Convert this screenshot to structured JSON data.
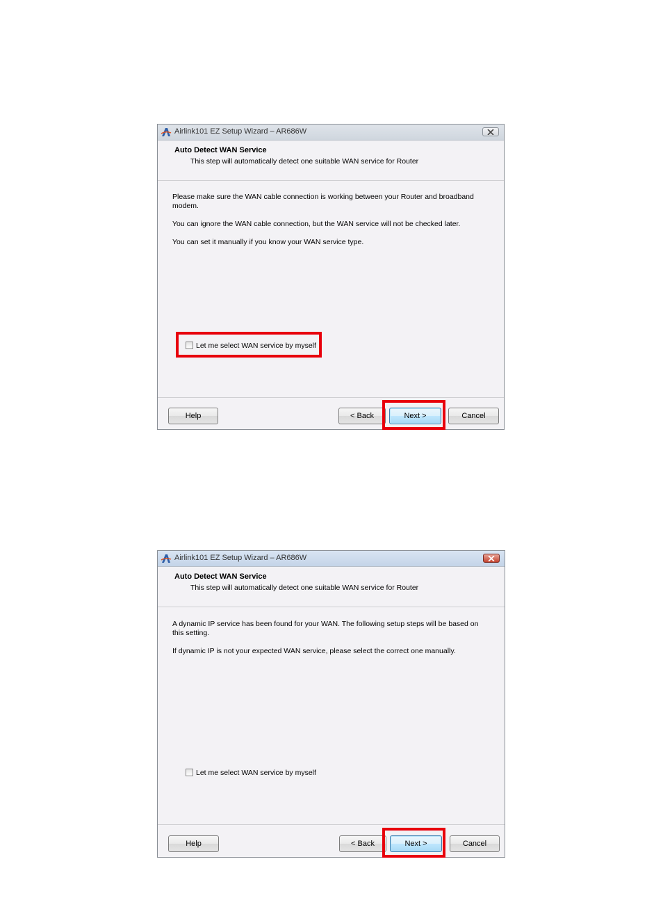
{
  "dialogs": [
    {
      "window_title": "Airlink101 EZ Setup Wizard – AR686W",
      "header_title": "Auto Detect WAN Service",
      "header_subtitle": "This step will automatically detect one suitable WAN service for Router",
      "paragraphs": [
        "Please make sure the WAN cable connection is working between your Router and broadband modem.",
        "You can ignore the WAN cable connection, but the WAN service will not be checked later.",
        "You can set it manually if you know your WAN service type."
      ],
      "checkbox_label": "Let me select WAN service by myself",
      "checkbox_checked": false,
      "buttons": {
        "help": "Help",
        "back": "< Back",
        "next": "Next >",
        "cancel": "Cancel"
      }
    },
    {
      "window_title": "Airlink101 EZ Setup Wizard – AR686W",
      "header_title": "Auto Detect WAN Service",
      "header_subtitle": "This step will automatically detect one suitable WAN service for Router",
      "paragraphs": [
        "A dynamic IP service has been found for your WAN. The following setup steps will be based on this setting.",
        "If dynamic IP is not your expected WAN service, please select the correct one manually."
      ],
      "checkbox_label": "Let me select WAN service by myself",
      "checkbox_checked": false,
      "buttons": {
        "help": "Help",
        "back": "< Back",
        "next": "Next >",
        "cancel": "Cancel"
      }
    }
  ],
  "colors": {
    "highlight": "#e8000b",
    "dialog_bg": "#f3f2f5",
    "default_button_border": "#3c7fb1"
  },
  "icons": {
    "app": "airlink-logo-icon",
    "close": "close-icon"
  }
}
